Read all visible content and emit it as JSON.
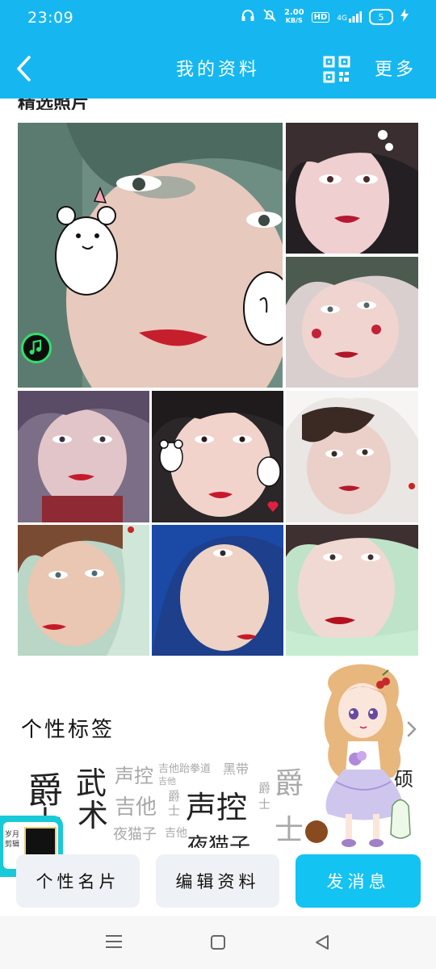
{
  "status": {
    "time": "23:09",
    "net_speed_value": "2.00",
    "net_speed_unit": "KB/S",
    "hd": "HD",
    "signal": "4G",
    "battery": "5"
  },
  "header": {
    "title": "我的资料",
    "more_label": "更多"
  },
  "colors": {
    "brand": "#16b7f0",
    "primary_button": "#13c3f2",
    "secondary_button": "#eef1f5"
  },
  "photos_section": {
    "title": "精选照片",
    "photo_count": 9
  },
  "tags_section": {
    "title": "个性标签",
    "tags": [
      {
        "text": "爵"
      },
      {
        "text": "士"
      },
      {
        "text": "武"
      },
      {
        "text": "术"
      },
      {
        "text": "声控"
      },
      {
        "text": "吉他"
      },
      {
        "text": "夜猫子"
      },
      {
        "text": "夜猫子"
      },
      {
        "text": "声控"
      },
      {
        "text": "吉他"
      },
      {
        "text": "吉他跆拳道"
      },
      {
        "text": "黑带"
      },
      {
        "text": "爵"
      },
      {
        "text": "士"
      },
      {
        "text": "爵"
      },
      {
        "text": "士"
      },
      {
        "text": "吉他"
      },
      {
        "text": "爵"
      },
      {
        "text": "士"
      },
      {
        "text": "硕"
      }
    ]
  },
  "mini_card": {
    "text_line1": "岁月",
    "text_line2": "剪辑"
  },
  "actions": {
    "profile_card": "个性名片",
    "edit_profile": "编辑资料",
    "send_message": "发消息"
  }
}
